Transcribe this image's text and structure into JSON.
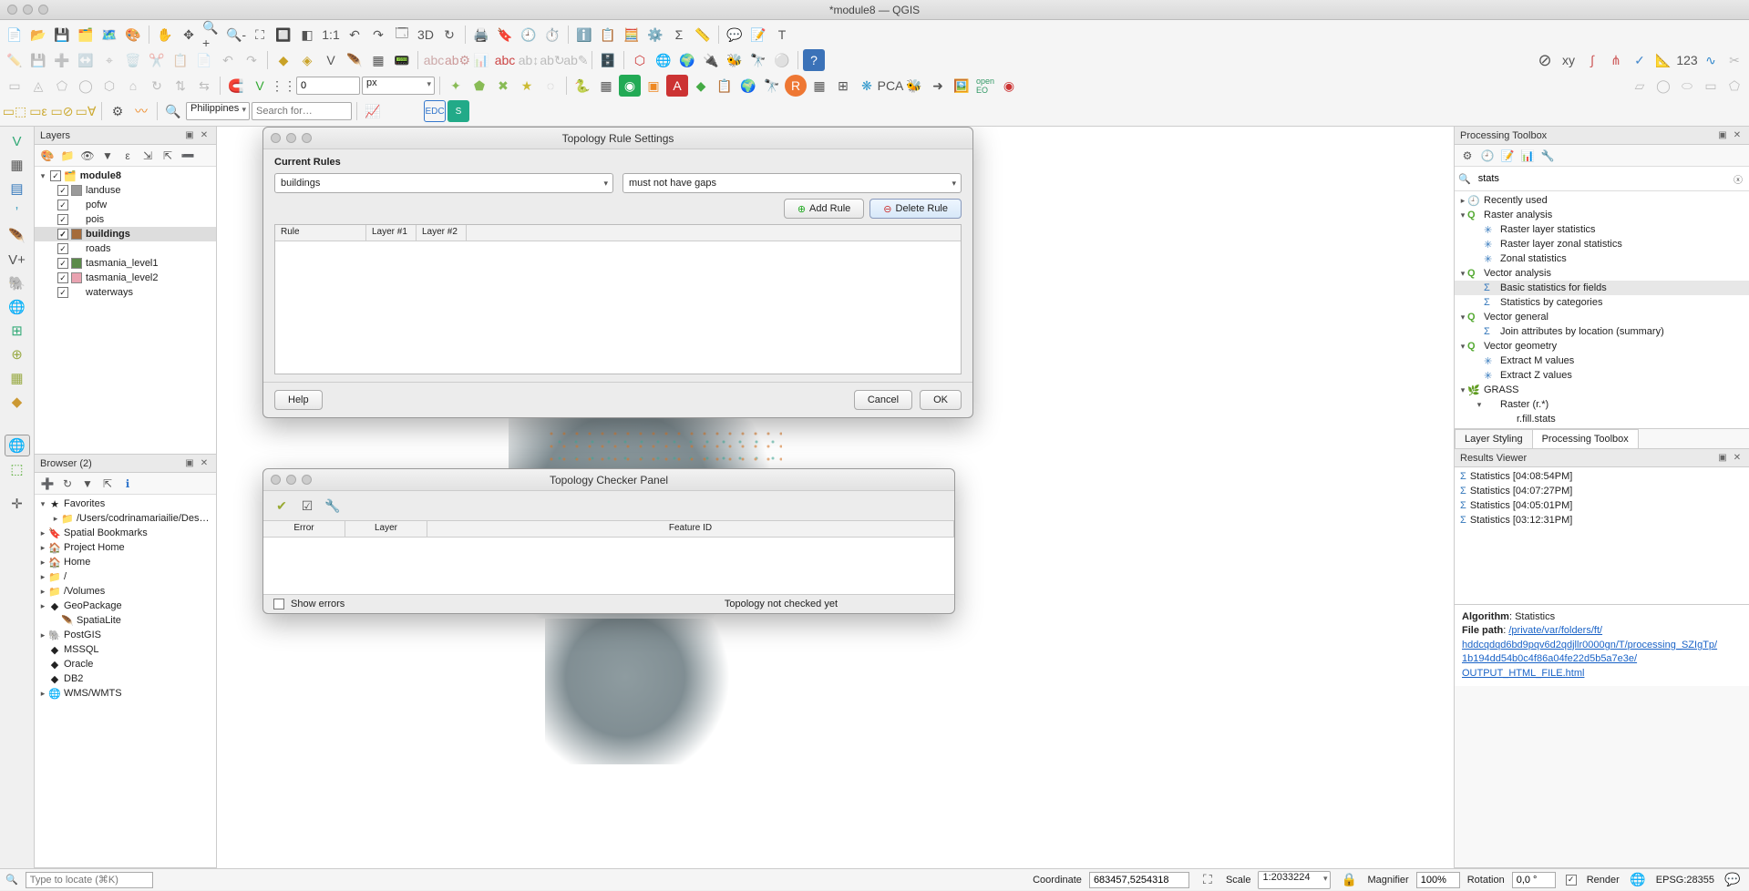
{
  "title": "*module8 — QGIS",
  "toolbar_row4": {
    "country": "Philippines",
    "search_placeholder": "Search for…",
    "spin_value": "0",
    "spin_unit": "px"
  },
  "layers_panel": {
    "title": "Layers",
    "group": "module8",
    "items": [
      {
        "name": "landuse",
        "color": "#9a9a9a"
      },
      {
        "name": "pofw",
        "color": ""
      },
      {
        "name": "pois",
        "color": ""
      },
      {
        "name": "buildings",
        "color": "#a56b3a",
        "selected": true
      },
      {
        "name": "roads",
        "color": ""
      },
      {
        "name": "tasmania_level1",
        "color": "#5b8a4a"
      },
      {
        "name": "tasmania_level2",
        "color": "#e9a3b1"
      },
      {
        "name": "waterways",
        "color": ""
      }
    ]
  },
  "browser_panel": {
    "title": "Browser (2)",
    "items": [
      {
        "icon": "★",
        "label": "Favorites",
        "exp": true
      },
      {
        "icon": "📁",
        "label": "/Users/codrinamariailie/Des…",
        "indent": 1
      },
      {
        "icon": "🔖",
        "label": "Spatial Bookmarks"
      },
      {
        "icon": "🏠",
        "label": "Project Home"
      },
      {
        "icon": "🏠",
        "label": "Home"
      },
      {
        "icon": "📁",
        "label": "/"
      },
      {
        "icon": "📁",
        "label": "/Volumes"
      },
      {
        "icon": "◆",
        "label": "GeoPackage"
      },
      {
        "icon": "🪶",
        "label": "SpatiaLite",
        "indent": 1,
        "noexp": true
      },
      {
        "icon": "🐘",
        "label": "PostGIS"
      },
      {
        "icon": "◆",
        "label": "MSSQL",
        "noexp": true
      },
      {
        "icon": "◆",
        "label": "Oracle",
        "noexp": true
      },
      {
        "icon": "◆",
        "label": "DB2",
        "noexp": true
      },
      {
        "icon": "🌐",
        "label": "WMS/WMTS"
      }
    ]
  },
  "topology_dialog": {
    "title": "Topology Rule Settings",
    "section": "Current Rules",
    "layer_select": "buildings",
    "rule_select": "must not have gaps",
    "add_btn": "Add Rule",
    "del_btn": "Delete Rule",
    "columns": [
      "Rule",
      "Layer #1",
      "Layer #2"
    ],
    "help": "Help",
    "cancel": "Cancel",
    "ok": "OK"
  },
  "topo_checker": {
    "title": "Topology Checker Panel",
    "columns": [
      "Error",
      "Layer",
      "Feature ID"
    ],
    "show_errors": "Show errors",
    "status": "Topology not checked yet"
  },
  "processing": {
    "title": "Processing Toolbox",
    "search_value": "stats",
    "tree": [
      {
        "icon": "🕘",
        "label": "Recently used",
        "exp": false
      },
      {
        "icon": "Q",
        "label": "Raster analysis",
        "exp": true,
        "q": true
      },
      {
        "icon": "✳",
        "label": "Raster layer statistics",
        "indent": 1
      },
      {
        "icon": "✳",
        "label": "Raster layer zonal statistics",
        "indent": 1
      },
      {
        "icon": "✳",
        "label": "Zonal statistics",
        "indent": 1
      },
      {
        "icon": "Q",
        "label": "Vector analysis",
        "exp": true,
        "q": true
      },
      {
        "icon": "Σ",
        "label": "Basic statistics for fields",
        "indent": 1,
        "sel": true
      },
      {
        "icon": "Σ",
        "label": "Statistics by categories",
        "indent": 1
      },
      {
        "icon": "Q",
        "label": "Vector general",
        "exp": true,
        "q": true
      },
      {
        "icon": "Σ",
        "label": "Join attributes by location (summary)",
        "indent": 1
      },
      {
        "icon": "Q",
        "label": "Vector geometry",
        "exp": true,
        "q": true
      },
      {
        "icon": "✳",
        "label": "Extract M values",
        "indent": 1
      },
      {
        "icon": "✳",
        "label": "Extract Z values",
        "indent": 1
      },
      {
        "icon": "🌿",
        "label": "GRASS",
        "exp": true
      },
      {
        "icon": "",
        "label": "Raster (r.*)",
        "indent": 1,
        "exp": true
      },
      {
        "icon": "",
        "label": "r.fill.stats",
        "indent": 2
      }
    ],
    "tabs": [
      "Layer Styling",
      "Processing Toolbox"
    ]
  },
  "results": {
    "title": "Results Viewer",
    "items": [
      "Statistics [04:08:54PM]",
      "Statistics [04:07:27PM]",
      "Statistics [04:05:01PM]",
      "Statistics [03:12:31PM]"
    ],
    "algo_label": "Algorithm",
    "algo_value": ": Statistics",
    "file_label": "File path",
    "file_link1": "/private/var/folders/ft/",
    "file_link2": "hddcqdqd6bd9pqv6d2qdjllr0000gn/T/processing_SZIgTp/",
    "file_link3": "1b194dd54b0c4f86a04fe22d5b5a7e3e/",
    "file_link4": "OUTPUT_HTML_FILE.html"
  },
  "status": {
    "locate_placeholder": "Type to locate (⌘K)",
    "coord_label": "Coordinate",
    "coord_value": "683457,5254318",
    "scale_label": "Scale",
    "scale_value": "1:2033224",
    "mag_label": "Magnifier",
    "mag_value": "100%",
    "rot_label": "Rotation",
    "rot_value": "0,0 °",
    "render": "Render",
    "epsg": "EPSG:28355"
  }
}
